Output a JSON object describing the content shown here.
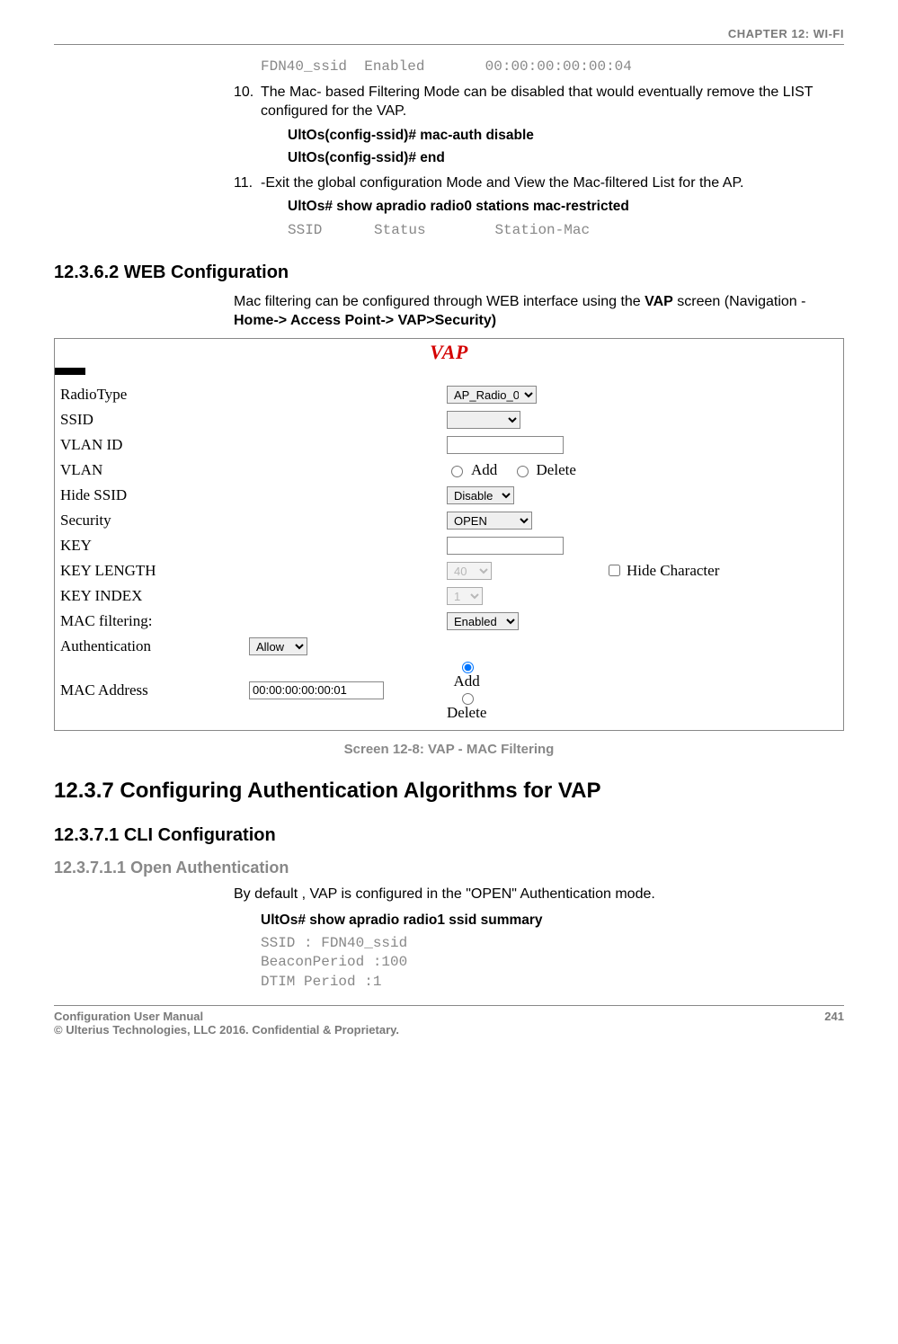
{
  "header": {
    "chapter": "CHAPTER 12: WI-FI"
  },
  "topcode": "FDN40_ssid  Enabled       00:00:00:00:00:04",
  "steps": {
    "s10_num": "10.",
    "s10_text": "The Mac- based Filtering Mode can be disabled that would eventually remove the LIST configured for the VAP.",
    "s10_cmd1": "UltOs(config-ssid)# mac-auth disable",
    "s10_cmd2": "UltOs(config-ssid)# end",
    "s11_num": "11.",
    "s11_text": "-Exit the global configuration Mode and View the Mac-filtered List for the AP.",
    "s11_cmd1": "UltOs# show apradio radio0 stations mac-restricted",
    "s11_out": "SSID      Status        Station-Mac"
  },
  "sec_12362": "12.3.6.2   WEB Configuration",
  "webcfg_pre": "Mac filtering can be configured through WEB interface using the ",
  "webcfg_bold1": "VAP",
  "webcfg_mid": " screen (Navigation - ",
  "webcfg_bold2": "Home-> Access Point-> VAP>Security)",
  "vap": {
    "title": "VAP",
    "rows": {
      "radiotype_label": "RadioType",
      "radiotype_value": "AP_Radio_0",
      "ssid_label": "SSID",
      "vlanid_label": "VLAN ID",
      "vlan_label": "VLAN",
      "vlan_add": "Add",
      "vlan_delete": "Delete",
      "hidessid_label": "Hide SSID",
      "hidessid_value": "Disable",
      "security_label": "Security",
      "security_value": "OPEN",
      "key_label": "KEY",
      "keylen_label": "KEY LENGTH",
      "keylen_value": "40",
      "hidechar_label": "Hide Character",
      "keyidx_label": "KEY INDEX",
      "keyidx_value": "1",
      "macfilt_label": "MAC filtering:",
      "macfilt_value": "Enabled",
      "auth_label": "Authentication",
      "auth_value": "Allow",
      "macaddr_label": "MAC Address",
      "macaddr_value": "00:00:00:00:00:01",
      "macaddr_add": "Add",
      "macaddr_delete": "Delete"
    }
  },
  "fig_caption": "Screen 12-8: VAP - MAC Filtering",
  "sec_1237": "12.3.7   Configuring Authentication Algorithms for VAP",
  "sec_12371": "12.3.7.1   CLI Configuration",
  "sec_123711": "12.3.7.1.1 Open Authentication",
  "open_text": "By default , VAP is configured in the \"OPEN\" Authentication mode.",
  "open_cmd": "UltOs# show apradio radio1 ssid summary",
  "open_out1": "SSID : FDN40_ssid",
  "open_out2": "BeaconPeriod :100",
  "open_out3": "DTIM Period :1",
  "footer": {
    "left1": "Configuration User Manual",
    "left2": "© Ulterius Technologies, LLC 2016. Confidential & Proprietary.",
    "page": "241"
  }
}
